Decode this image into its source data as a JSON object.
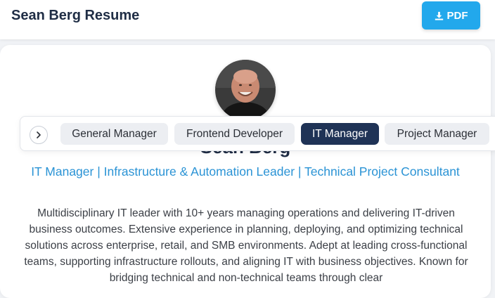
{
  "header": {
    "title": "Sean Berg Resume",
    "pdf_label": "PDF",
    "download_icon": "download-icon"
  },
  "profile": {
    "avatar_icon": "profile-photo",
    "name": "Sean Berg",
    "headline": "IT Manager | Infrastructure & Automation Leader | Technical Project Consultant",
    "summary": "Multidisciplinary IT leader with 10+ years managing operations and delivering IT-driven business outcomes. Extensive experience in planning, deploying, and optimizing technical solutions across enterprise, retail, and SMB environments. Adept at leading cross-functional teams, supporting infrastructure rollouts, and aligning IT with business objectives. Known for bridging technical and non-technical teams through clear"
  },
  "role_selector": {
    "scroll_icon": "chevron-right-icon",
    "roles": [
      {
        "label": "General Manager",
        "active": false
      },
      {
        "label": "Frontend Developer",
        "active": false
      },
      {
        "label": "IT Manager",
        "active": true
      },
      {
        "label": "Project Manager",
        "active": false
      }
    ]
  },
  "colors": {
    "accent": "#22a8ec",
    "headline": "#2a93d5",
    "active_chip": "#1f3356",
    "chip": "#eceef2"
  }
}
